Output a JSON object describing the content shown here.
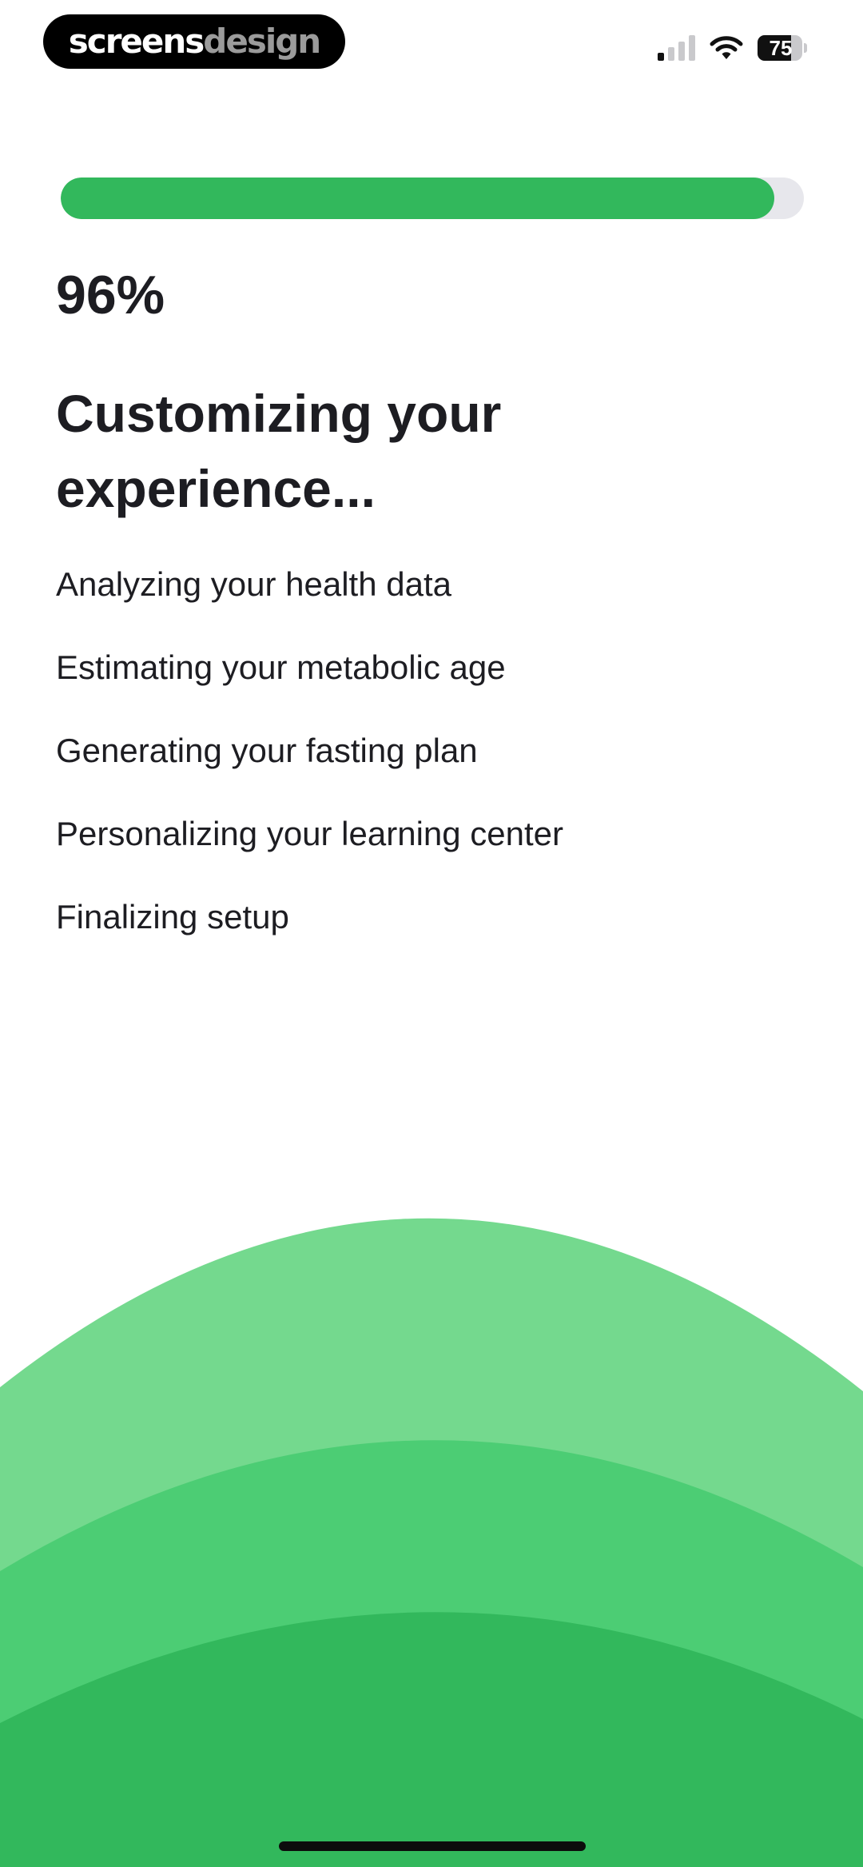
{
  "watermark": {
    "part1": "screens",
    "part2": "design"
  },
  "status_bar": {
    "signal_icon": "cellular-signal-icon",
    "signal_bars_active": 1,
    "signal_bars_total": 4,
    "wifi_icon": "wifi-icon",
    "battery_icon": "battery-icon",
    "battery_level": "75"
  },
  "progress": {
    "percent": 96,
    "label": "96%"
  },
  "title": "Customizing your experience...",
  "steps": [
    "Analyzing your health data",
    "Estimating your metabolic age",
    "Generating your fasting plan",
    "Personalizing your learning center",
    "Finalizing setup"
  ],
  "colors": {
    "accent": "#32b85c",
    "track": "#e7e7ec",
    "text": "#1d1d22",
    "hill_light": "#74d98e",
    "hill_mid": "#4ccd74",
    "hill_dark": "#32b85c"
  }
}
